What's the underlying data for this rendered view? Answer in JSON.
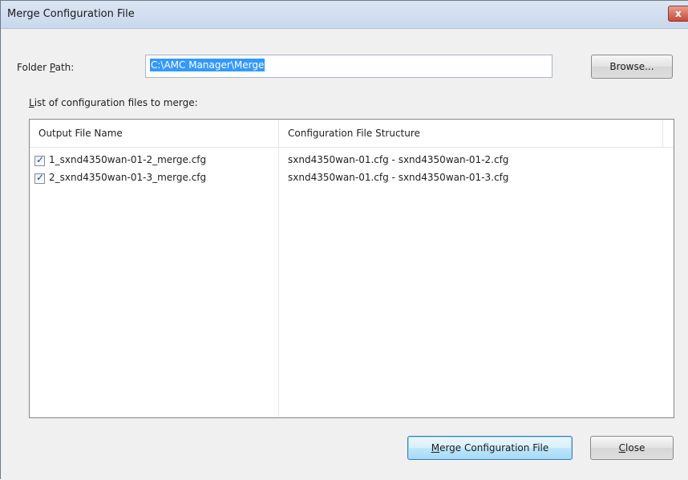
{
  "window": {
    "title": "Merge Configuration File",
    "close_glyph": "x"
  },
  "folder": {
    "label_pre": "Folder ",
    "label_accel": "P",
    "label_post": "ath:",
    "value": "C:\\AMC Manager\\Merge",
    "browse_label": "Browse..."
  },
  "list": {
    "label_accel": "L",
    "label_post": "ist of configuration files to merge:",
    "columns": [
      "Output File Name",
      "Configuration File Structure"
    ],
    "rows": [
      {
        "checked": true,
        "output": "1_sxnd4350wan-01-2_merge.cfg",
        "structure": "sxnd4350wan-01.cfg - sxnd4350wan-01-2.cfg"
      },
      {
        "checked": true,
        "output": "2_sxnd4350wan-01-3_merge.cfg",
        "structure": "sxnd4350wan-01.cfg - sxnd4350wan-01-3.cfg"
      }
    ]
  },
  "buttons": {
    "merge_accel": "M",
    "merge_post": "erge Configuration File",
    "close_accel": "C",
    "close_post": "lose"
  },
  "icons": {
    "checkbox_check": "✓"
  },
  "colors": {
    "selection": "#3399ff",
    "default_button": "#bee6fd",
    "titlebar": "#c9d8ec"
  }
}
